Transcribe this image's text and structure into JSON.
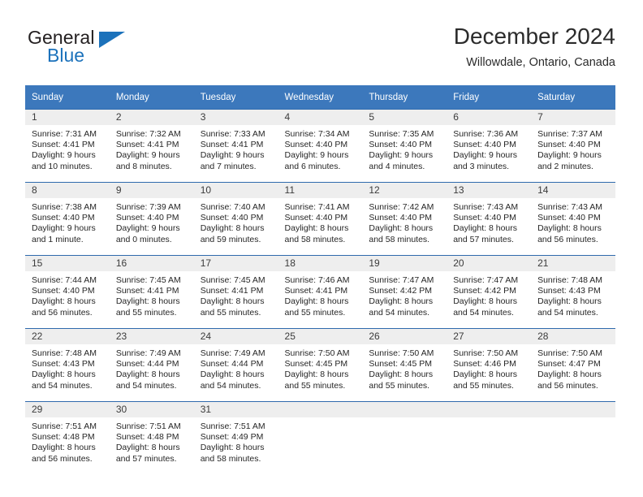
{
  "brand": {
    "name_top": "General",
    "name_bottom": "Blue",
    "accent_color": "#1c72bb",
    "triangle_icon": "triangle-icon"
  },
  "header": {
    "title": "December 2024",
    "subtitle": "Willowdale, Ontario, Canada"
  },
  "calendar": {
    "header_bg": "#3c78bc",
    "header_text_color": "#ffffff",
    "daynum_bg": "#eeeeee",
    "row_border_color": "#2f6aad",
    "weekdays": [
      "Sunday",
      "Monday",
      "Tuesday",
      "Wednesday",
      "Thursday",
      "Friday",
      "Saturday"
    ],
    "weeks": [
      [
        {
          "day": "1",
          "sunrise": "Sunrise: 7:31 AM",
          "sunset": "Sunset: 4:41 PM",
          "daylight1": "Daylight: 9 hours",
          "daylight2": "and 10 minutes."
        },
        {
          "day": "2",
          "sunrise": "Sunrise: 7:32 AM",
          "sunset": "Sunset: 4:41 PM",
          "daylight1": "Daylight: 9 hours",
          "daylight2": "and 8 minutes."
        },
        {
          "day": "3",
          "sunrise": "Sunrise: 7:33 AM",
          "sunset": "Sunset: 4:41 PM",
          "daylight1": "Daylight: 9 hours",
          "daylight2": "and 7 minutes."
        },
        {
          "day": "4",
          "sunrise": "Sunrise: 7:34 AM",
          "sunset": "Sunset: 4:40 PM",
          "daylight1": "Daylight: 9 hours",
          "daylight2": "and 6 minutes."
        },
        {
          "day": "5",
          "sunrise": "Sunrise: 7:35 AM",
          "sunset": "Sunset: 4:40 PM",
          "daylight1": "Daylight: 9 hours",
          "daylight2": "and 4 minutes."
        },
        {
          "day": "6",
          "sunrise": "Sunrise: 7:36 AM",
          "sunset": "Sunset: 4:40 PM",
          "daylight1": "Daylight: 9 hours",
          "daylight2": "and 3 minutes."
        },
        {
          "day": "7",
          "sunrise": "Sunrise: 7:37 AM",
          "sunset": "Sunset: 4:40 PM",
          "daylight1": "Daylight: 9 hours",
          "daylight2": "and 2 minutes."
        }
      ],
      [
        {
          "day": "8",
          "sunrise": "Sunrise: 7:38 AM",
          "sunset": "Sunset: 4:40 PM",
          "daylight1": "Daylight: 9 hours",
          "daylight2": "and 1 minute."
        },
        {
          "day": "9",
          "sunrise": "Sunrise: 7:39 AM",
          "sunset": "Sunset: 4:40 PM",
          "daylight1": "Daylight: 9 hours",
          "daylight2": "and 0 minutes."
        },
        {
          "day": "10",
          "sunrise": "Sunrise: 7:40 AM",
          "sunset": "Sunset: 4:40 PM",
          "daylight1": "Daylight: 8 hours",
          "daylight2": "and 59 minutes."
        },
        {
          "day": "11",
          "sunrise": "Sunrise: 7:41 AM",
          "sunset": "Sunset: 4:40 PM",
          "daylight1": "Daylight: 8 hours",
          "daylight2": "and 58 minutes."
        },
        {
          "day": "12",
          "sunrise": "Sunrise: 7:42 AM",
          "sunset": "Sunset: 4:40 PM",
          "daylight1": "Daylight: 8 hours",
          "daylight2": "and 58 minutes."
        },
        {
          "day": "13",
          "sunrise": "Sunrise: 7:43 AM",
          "sunset": "Sunset: 4:40 PM",
          "daylight1": "Daylight: 8 hours",
          "daylight2": "and 57 minutes."
        },
        {
          "day": "14",
          "sunrise": "Sunrise: 7:43 AM",
          "sunset": "Sunset: 4:40 PM",
          "daylight1": "Daylight: 8 hours",
          "daylight2": "and 56 minutes."
        }
      ],
      [
        {
          "day": "15",
          "sunrise": "Sunrise: 7:44 AM",
          "sunset": "Sunset: 4:40 PM",
          "daylight1": "Daylight: 8 hours",
          "daylight2": "and 56 minutes."
        },
        {
          "day": "16",
          "sunrise": "Sunrise: 7:45 AM",
          "sunset": "Sunset: 4:41 PM",
          "daylight1": "Daylight: 8 hours",
          "daylight2": "and 55 minutes."
        },
        {
          "day": "17",
          "sunrise": "Sunrise: 7:45 AM",
          "sunset": "Sunset: 4:41 PM",
          "daylight1": "Daylight: 8 hours",
          "daylight2": "and 55 minutes."
        },
        {
          "day": "18",
          "sunrise": "Sunrise: 7:46 AM",
          "sunset": "Sunset: 4:41 PM",
          "daylight1": "Daylight: 8 hours",
          "daylight2": "and 55 minutes."
        },
        {
          "day": "19",
          "sunrise": "Sunrise: 7:47 AM",
          "sunset": "Sunset: 4:42 PM",
          "daylight1": "Daylight: 8 hours",
          "daylight2": "and 54 minutes."
        },
        {
          "day": "20",
          "sunrise": "Sunrise: 7:47 AM",
          "sunset": "Sunset: 4:42 PM",
          "daylight1": "Daylight: 8 hours",
          "daylight2": "and 54 minutes."
        },
        {
          "day": "21",
          "sunrise": "Sunrise: 7:48 AM",
          "sunset": "Sunset: 4:43 PM",
          "daylight1": "Daylight: 8 hours",
          "daylight2": "and 54 minutes."
        }
      ],
      [
        {
          "day": "22",
          "sunrise": "Sunrise: 7:48 AM",
          "sunset": "Sunset: 4:43 PM",
          "daylight1": "Daylight: 8 hours",
          "daylight2": "and 54 minutes."
        },
        {
          "day": "23",
          "sunrise": "Sunrise: 7:49 AM",
          "sunset": "Sunset: 4:44 PM",
          "daylight1": "Daylight: 8 hours",
          "daylight2": "and 54 minutes."
        },
        {
          "day": "24",
          "sunrise": "Sunrise: 7:49 AM",
          "sunset": "Sunset: 4:44 PM",
          "daylight1": "Daylight: 8 hours",
          "daylight2": "and 54 minutes."
        },
        {
          "day": "25",
          "sunrise": "Sunrise: 7:50 AM",
          "sunset": "Sunset: 4:45 PM",
          "daylight1": "Daylight: 8 hours",
          "daylight2": "and 55 minutes."
        },
        {
          "day": "26",
          "sunrise": "Sunrise: 7:50 AM",
          "sunset": "Sunset: 4:45 PM",
          "daylight1": "Daylight: 8 hours",
          "daylight2": "and 55 minutes."
        },
        {
          "day": "27",
          "sunrise": "Sunrise: 7:50 AM",
          "sunset": "Sunset: 4:46 PM",
          "daylight1": "Daylight: 8 hours",
          "daylight2": "and 55 minutes."
        },
        {
          "day": "28",
          "sunrise": "Sunrise: 7:50 AM",
          "sunset": "Sunset: 4:47 PM",
          "daylight1": "Daylight: 8 hours",
          "daylight2": "and 56 minutes."
        }
      ],
      [
        {
          "day": "29",
          "sunrise": "Sunrise: 7:51 AM",
          "sunset": "Sunset: 4:48 PM",
          "daylight1": "Daylight: 8 hours",
          "daylight2": "and 56 minutes."
        },
        {
          "day": "30",
          "sunrise": "Sunrise: 7:51 AM",
          "sunset": "Sunset: 4:48 PM",
          "daylight1": "Daylight: 8 hours",
          "daylight2": "and 57 minutes."
        },
        {
          "day": "31",
          "sunrise": "Sunrise: 7:51 AM",
          "sunset": "Sunset: 4:49 PM",
          "daylight1": "Daylight: 8 hours",
          "daylight2": "and 58 minutes."
        },
        {
          "day": "",
          "sunrise": "",
          "sunset": "",
          "daylight1": "",
          "daylight2": ""
        },
        {
          "day": "",
          "sunrise": "",
          "sunset": "",
          "daylight1": "",
          "daylight2": ""
        },
        {
          "day": "",
          "sunrise": "",
          "sunset": "",
          "daylight1": "",
          "daylight2": ""
        },
        {
          "day": "",
          "sunrise": "",
          "sunset": "",
          "daylight1": "",
          "daylight2": ""
        }
      ]
    ]
  }
}
